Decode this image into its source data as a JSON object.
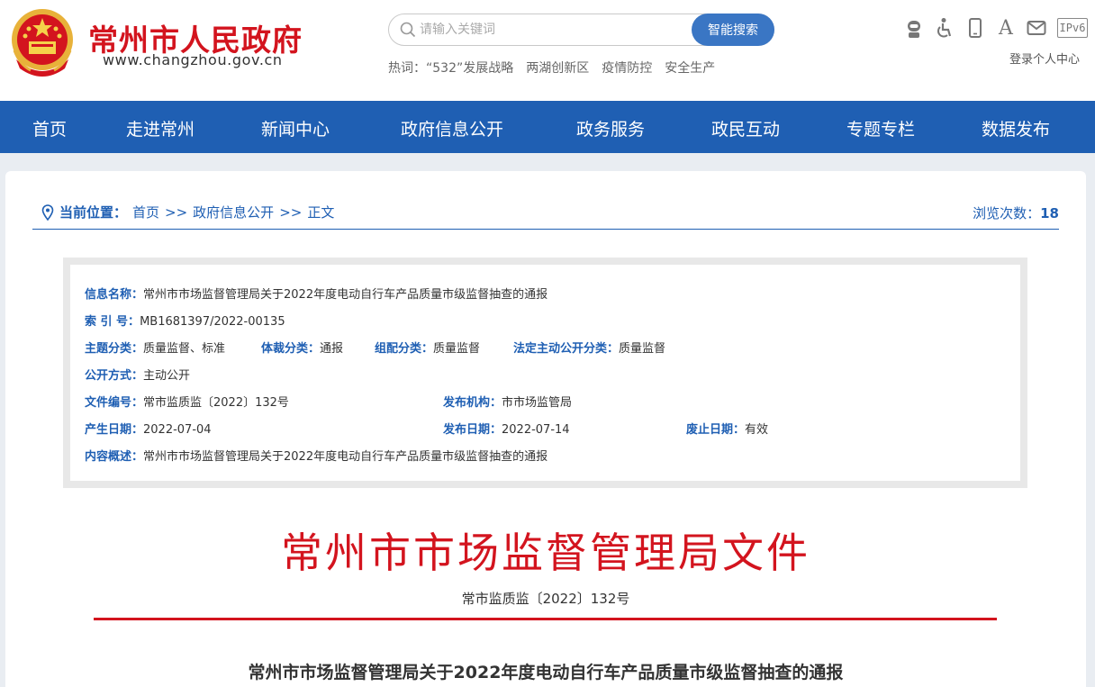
{
  "header": {
    "site_title": "常州市人民政府",
    "site_url": "www.changzhou.gov.cn",
    "search_placeholder": "请输入关键词",
    "search_button": "智能搜索",
    "hotwords_label": "热词：",
    "hotwords": [
      "“532”发展战略",
      "两湖创新区",
      "疫情防控",
      "安全生产"
    ],
    "font_size_tool": "A",
    "ipv6_label": "IPv6",
    "login_label": "登录个人中心"
  },
  "nav": {
    "items": [
      "首页",
      "走进常州",
      "新闻中心",
      "政府信息公开",
      "政务服务",
      "政民互动",
      "专题专栏",
      "数据发布"
    ]
  },
  "breadcrumb": {
    "label": "当前位置：",
    "items": [
      "首页",
      ">>",
      "政府信息公开",
      ">>",
      "正文"
    ]
  },
  "views": {
    "label": "浏览次数：",
    "count": "18"
  },
  "meta": {
    "info_name_key": "信息名称：",
    "info_name": "常州市市场监督管理局关于2022年度电动自行车产品质量市级监督抽查的通报",
    "index_key": "索 引 号：",
    "index": "MB1681397/2022-00135",
    "topic_key": "主题分类：",
    "topic": "质量监督、标准",
    "genre_key": "体裁分类：",
    "genre": "通报",
    "org_key": "组配分类：",
    "org": "质量监督",
    "legal_key": "法定主动公开分类：",
    "legal": "质量监督",
    "open_key": "公开方式：",
    "open": "主动公开",
    "doc_no_key": "文件编号：",
    "doc_no": "常市监质监〔2022〕132号",
    "publisher_key": "发布机构：",
    "publisher": "市市场监管局",
    "created_key": "产生日期：",
    "created": "2022-07-04",
    "published_key": "发布日期：",
    "published": "2022-07-14",
    "expire_key": "废止日期：",
    "expire": "有效",
    "summary_key": "内容概述：",
    "summary": "常州市市场监督管理局关于2022年度电动自行车产品质量市级监督抽查的通报"
  },
  "document": {
    "header_title": "常州市市场监督管理局文件",
    "number": "常市监质监〔2022〕132号",
    "title": "常州市市场监督管理局关于2022年度电动自行车产品质量市级监督抽查的通报"
  },
  "colors": {
    "brand_red": "#d3141e",
    "nav_blue": "#1f5fb3",
    "button_blue": "#3a76c4"
  }
}
